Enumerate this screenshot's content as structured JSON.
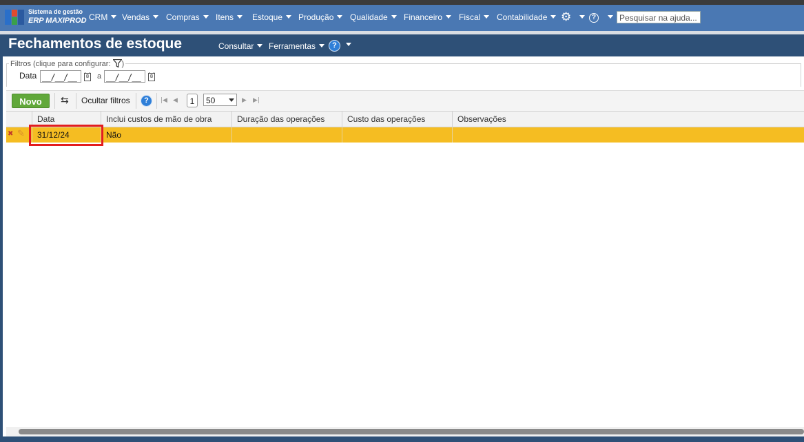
{
  "app": {
    "brand_line1": "Sistema de gestão",
    "brand_line2": "ERP MAXIPROD",
    "menu": [
      "CRM",
      "Vendas",
      "Compras",
      "Itens",
      "Estoque",
      "Produção",
      "Qualidade",
      "Financeiro",
      "Fiscal",
      "Contabilidade"
    ],
    "search_placeholder": "Pesquisar na ajuda..."
  },
  "page": {
    "title": "Fechamentos de estoque",
    "consultar": "Consultar",
    "ferramentas": "Ferramentas"
  },
  "filters": {
    "legend": "Filtros (clique para configurar:",
    "legend_end": ")",
    "date_label": "Data",
    "date_from": "__/__/__",
    "separator": "a",
    "date_to": "__/__/__"
  },
  "toolbar": {
    "new_label": "Novo",
    "hide_filters_label": "Ocultar filtros",
    "page_number": "1",
    "page_size": "50"
  },
  "table": {
    "columns": [
      "Data",
      "Inclui custos de mão de obra",
      "Duração das operações",
      "Custo das operações",
      "Observações"
    ],
    "rows": [
      {
        "data": "31/12/24",
        "inclui_custos": "Não",
        "duracao": "",
        "custo": "",
        "observacoes": ""
      }
    ]
  },
  "colors": {
    "navbar": "#4a78b3",
    "titlebar": "#2e5077",
    "selected_row": "#f5bd22",
    "new_button": "#61a83a",
    "highlight_border": "#e31d1d"
  },
  "icons": [
    "logo-icon",
    "gear-icon",
    "help-circle-icon",
    "filter-icon",
    "calendar-icon",
    "refresh-icon",
    "help-icon",
    "first-page-icon",
    "prev-page-icon",
    "next-page-icon",
    "last-page-icon",
    "delete-icon",
    "edit-icon"
  ]
}
